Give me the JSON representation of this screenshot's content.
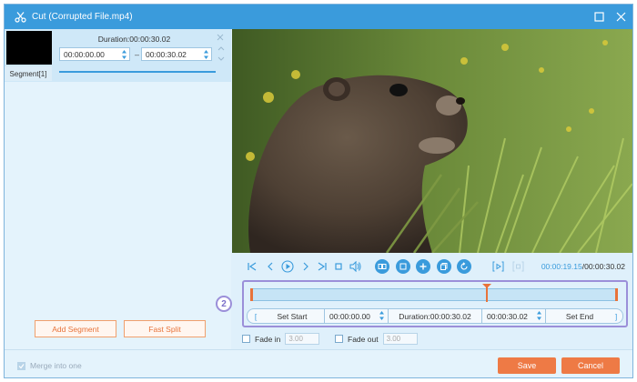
{
  "window": {
    "title": "Cut (Corrupted File.mp4)"
  },
  "segment": {
    "duration_label": "Duration:00:00:30.02",
    "start_time": "00:00:00.00",
    "end_time": "00:00:30.02",
    "dash": "–",
    "label": "Segment[1]"
  },
  "left_buttons": {
    "add_segment": "Add Segment",
    "fast_split": "Fast Split"
  },
  "playback": {
    "current_time": "00:00:19.15",
    "separator": "/",
    "total_time": "00:00:30.02"
  },
  "callout": {
    "number": "2"
  },
  "trim_bar": {
    "set_start": "Set Start",
    "start_time": "00:00:00.00",
    "duration": "Duration:00:00:30.02",
    "end_time": "00:00:30.02",
    "set_end": "Set End",
    "open_bracket": "[",
    "close_bracket": "]"
  },
  "fade": {
    "fade_in_label": "Fade in",
    "fade_in_value": "3.00",
    "fade_out_label": "Fade out",
    "fade_out_value": "3.00"
  },
  "footer": {
    "merge_label": "Merge into one",
    "save": "Save",
    "cancel": "Cancel"
  },
  "colors": {
    "accent": "#3a9bdc",
    "orange": "#ee7a45",
    "highlight": "#9b8fd9"
  }
}
